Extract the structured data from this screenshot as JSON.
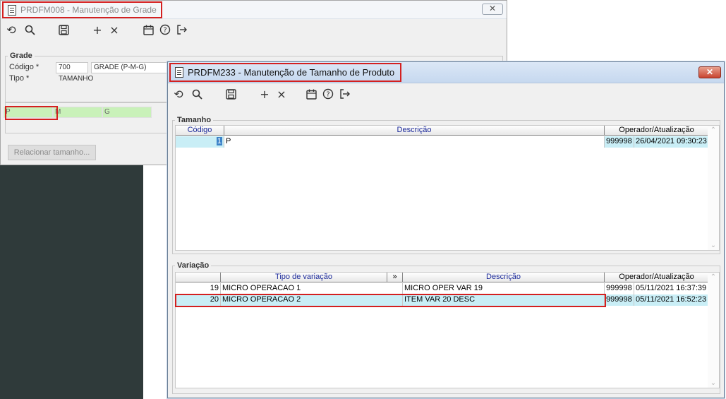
{
  "win1": {
    "title": "PRDFM008 - Manutenção de Grade",
    "close_glyph": "✕",
    "toolbar_icons": [
      "undo-icon",
      "search-icon",
      "save-icon",
      "add-icon",
      "delete-icon",
      "calendar-icon",
      "help-icon",
      "exit-icon"
    ],
    "grade_legend": "Grade",
    "codigo_label": "Código *",
    "codigo_value": "700",
    "codigo_desc": "GRADE (P-M-G)",
    "tipo_label": "Tipo *",
    "tipo_value": "TAMANHO",
    "sizes": [
      "P",
      "M",
      "G"
    ],
    "relacionar_button": "Relacionar tamanho..."
  },
  "win2": {
    "title": "PRDFM233 - Manutenção de Tamanho de Produto",
    "close_glyph": "✕",
    "tamanho": {
      "legend": "Tamanho",
      "headers": {
        "codigo": "Código",
        "descricao": "Descrição",
        "operador": "Operador/Atualização"
      },
      "rows": [
        {
          "codigo": "1",
          "descricao": "P",
          "operador": "999998",
          "data": "26/04/2021 09:30:23"
        }
      ]
    },
    "variacao": {
      "legend": "Variação",
      "headers": {
        "tipo": "Tipo de variação",
        "expand": "»",
        "descricao": "Descrição",
        "operador": "Operador/Atualização"
      },
      "rows": [
        {
          "codigo": "19",
          "tipo": "MICRO OPERACAO 1",
          "descricao": "MICRO OPER VAR 19",
          "operador": "999998",
          "data": "05/11/2021 16:37:39"
        },
        {
          "codigo": "20",
          "tipo": "MICRO OPERACAO 2",
          "descricao": "ITEM VAR 20 DESC",
          "operador": "999998",
          "data": "05/11/2021 16:52:23"
        }
      ]
    }
  },
  "colors": {
    "highlight_red": "#d42020",
    "row_selected": "#c9eef6",
    "size_cell": "#c9f1b9",
    "header_blue": "#1c2a9a"
  }
}
